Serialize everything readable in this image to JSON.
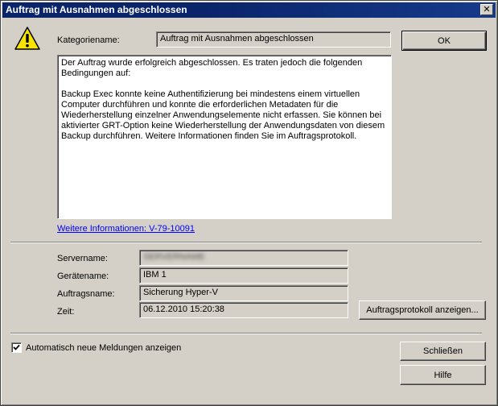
{
  "window": {
    "title": "Auftrag mit Ausnahmen abgeschlossen",
    "close_glyph": "✕"
  },
  "icons": {
    "warning": "warning-icon",
    "close": "close-icon",
    "checkmark": "checkmark-icon"
  },
  "category": {
    "label": "Kategoriename:",
    "value": "Auftrag mit Ausnahmen abgeschlossen"
  },
  "message": {
    "paragraphs": [
      "Der Auftrag wurde erfolgreich abgeschlossen. Es traten jedoch die folgenden Bedingungen auf:",
      "Backup Exec konnte keine Authentifizierung bei mindestens einem virtuellen Computer durchführen und konnte die erforderlichen Metadaten für die Wiederherstellung einzelner Anwendungselemente nicht erfassen. Sie können bei aktivierter GRT-Option keine Wiederherstellung der Anwendungsdaten von diesem Backup durchführen. Weitere Informationen finden Sie im Auftragsprotokoll."
    ]
  },
  "more_info_link": "Weitere Informationen: V-79-10091",
  "details": {
    "servername_label": "Servername:",
    "servername_value": "SERVERNAME",
    "device_label": "Gerätename:",
    "device_value": "IBM 1",
    "job_label": "Auftragsname:",
    "job_value": "Sicherung Hyper-V",
    "time_label": "Zeit:",
    "time_value": "06.12.2010 15:20:38"
  },
  "buttons": {
    "ok": "OK",
    "show_log": "Auftragsprotokoll anzeigen...",
    "close": "Schließen",
    "help": "Hilfe"
  },
  "auto_show": {
    "label": "Automatisch neue Meldungen anzeigen",
    "checked": true
  }
}
